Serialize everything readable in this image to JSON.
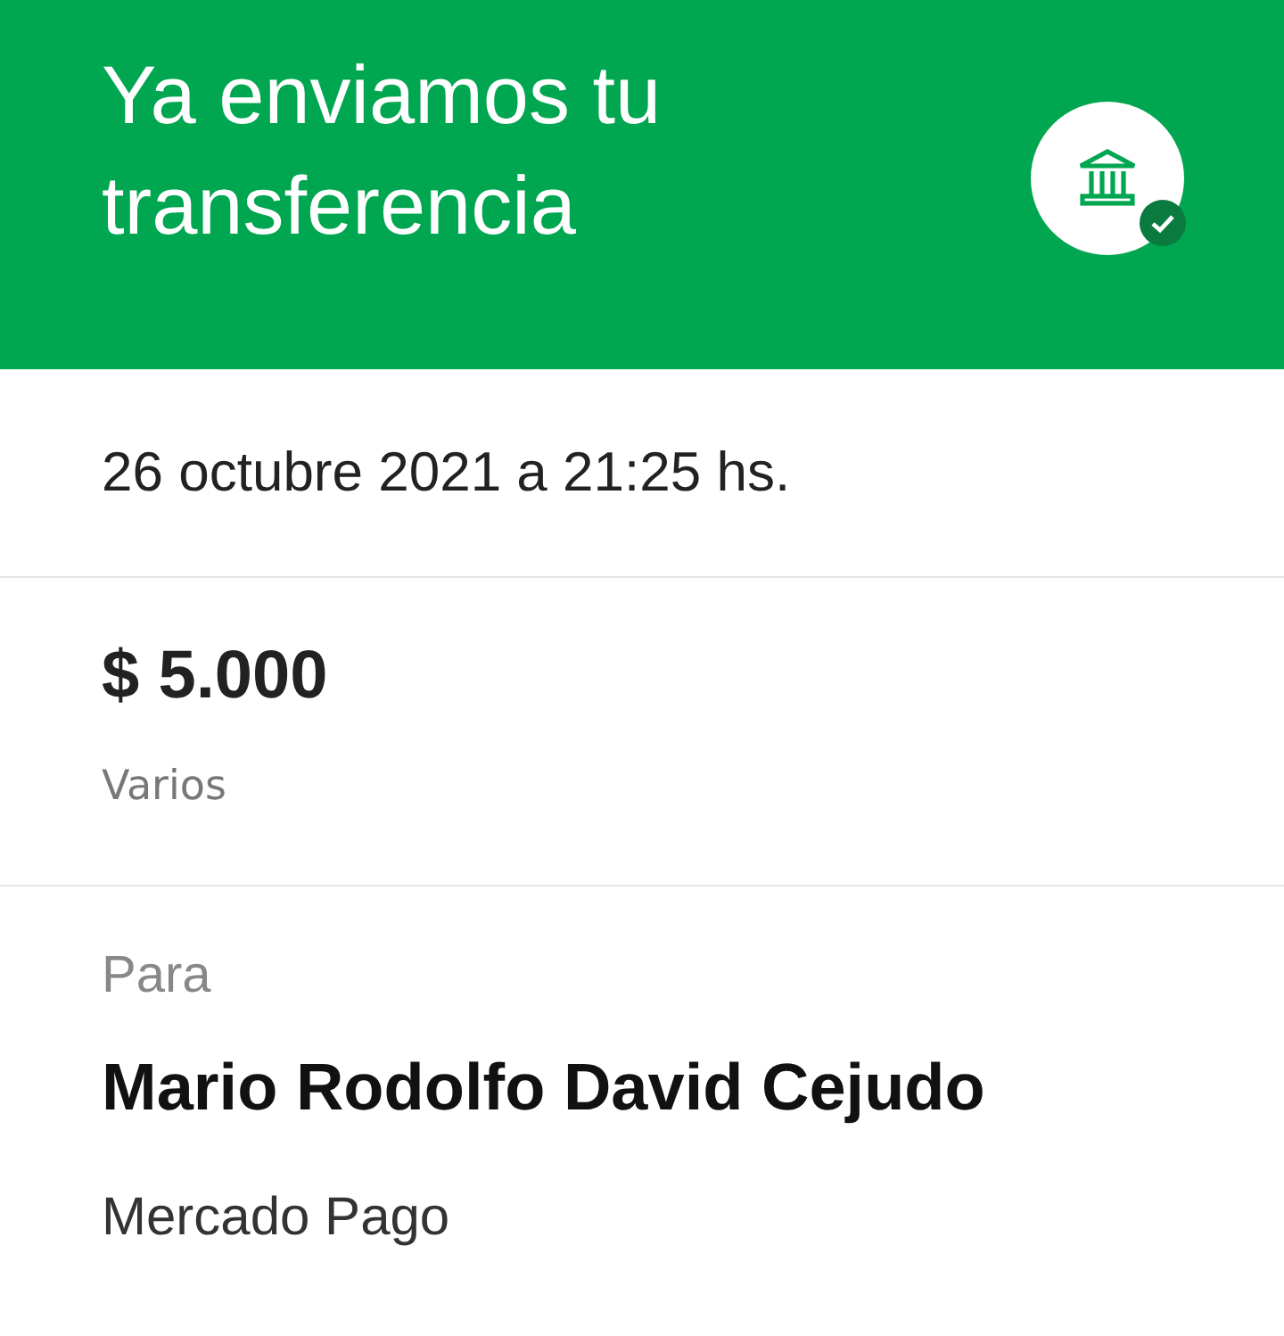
{
  "header": {
    "title": "Ya enviamos tu transferencia"
  },
  "date": "26 octubre 2021 a 21:25 hs.",
  "amount": "$ 5.000",
  "note": "Varios",
  "recipient": {
    "label": "Para",
    "name": "Mario Rodolfo David Cejudo",
    "bank": "Mercado Pago"
  }
}
